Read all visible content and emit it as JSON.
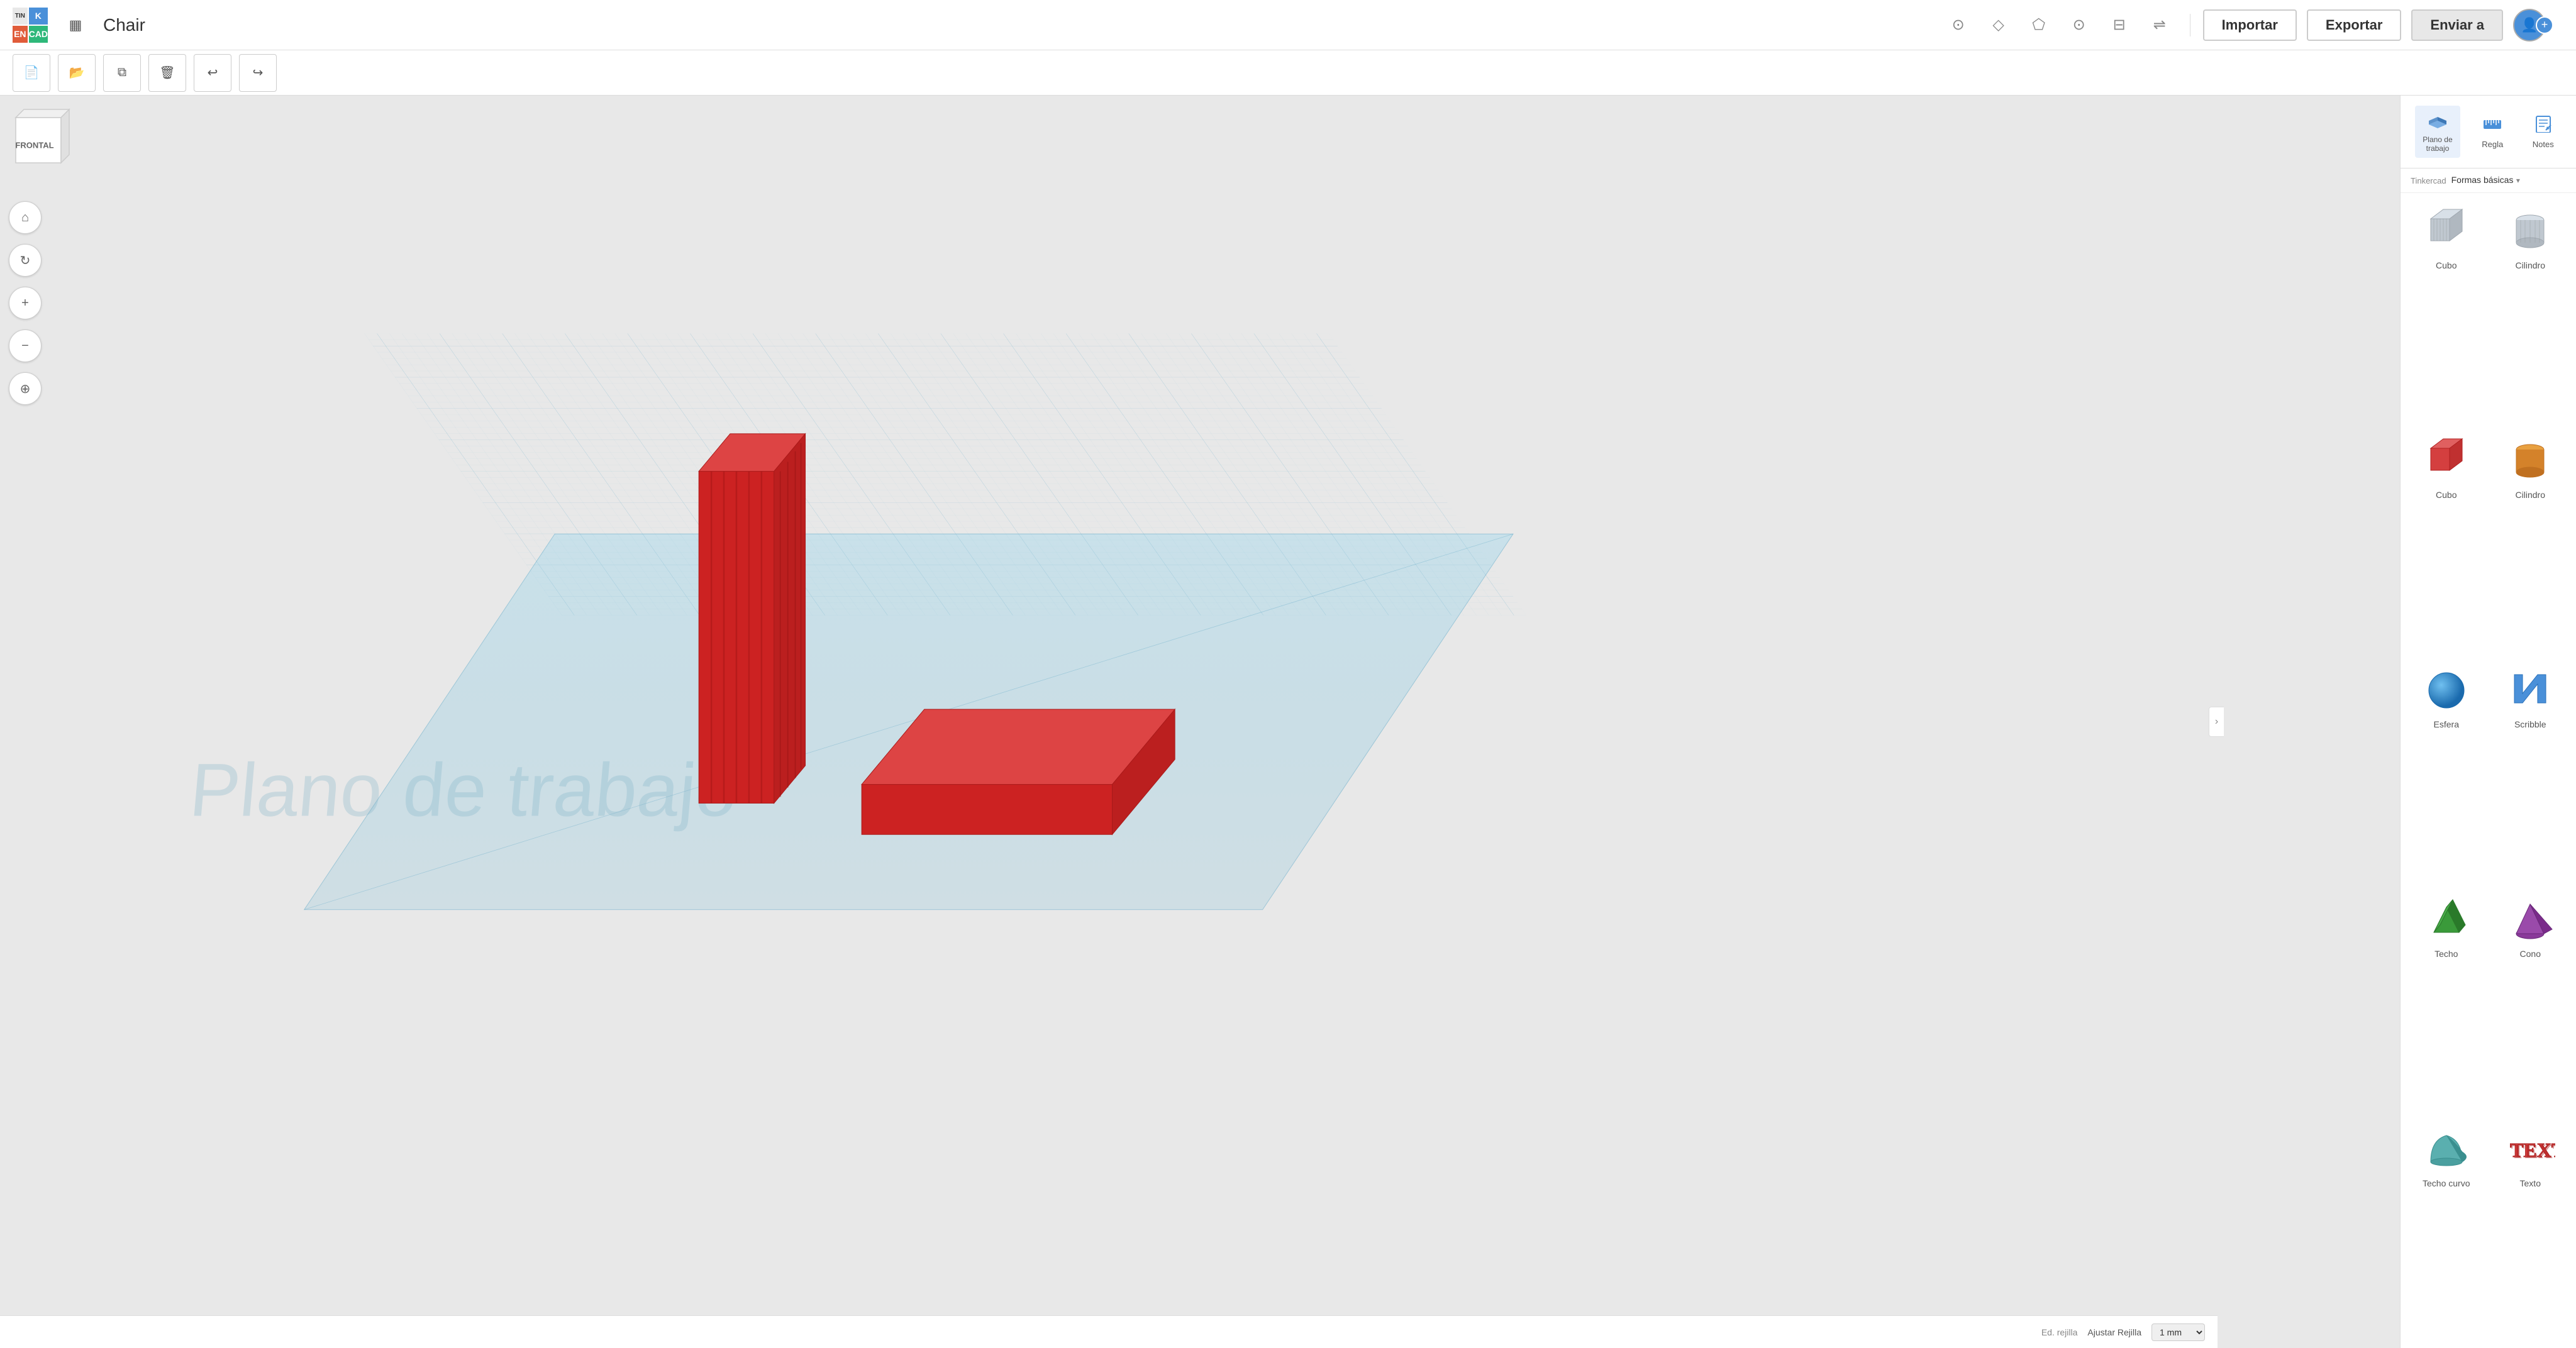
{
  "app": {
    "title": "Chair",
    "logo": {
      "cell1": "TIN",
      "cell2": "K",
      "cell3": "EN",
      "cell4": "CAD"
    }
  },
  "topbar": {
    "importar_label": "Importar",
    "exportar_label": "Exportar",
    "enviar_label": "Enviar a"
  },
  "toolbar2": {
    "buttons": [
      "new",
      "copy",
      "paste",
      "delete",
      "undo",
      "redo"
    ]
  },
  "left_controls": {
    "buttons": [
      "home",
      "orbit",
      "zoom_in",
      "zoom_out",
      "fit"
    ]
  },
  "viewport": {
    "workplane_label": "Plano de trabajo",
    "front_label": "FRONTAL"
  },
  "right_panel": {
    "plano_label": "Plano de\ntrabajo",
    "regla_label": "Regla",
    "notes_label": "Notes",
    "tinkercad_label": "Tinkercad",
    "category_label": "Formas básicas",
    "shapes": [
      {
        "id": "cubo-gray",
        "label": "Cubo",
        "color": "#b0b8c0",
        "type": "cube_gray"
      },
      {
        "id": "cilindro-gray",
        "label": "Cilindro",
        "color": "#b0b8c0",
        "type": "cylinder_gray"
      },
      {
        "id": "cubo-red",
        "label": "Cubo",
        "color": "#d43f3f",
        "type": "cube_red"
      },
      {
        "id": "cilindro-orange",
        "label": "Cilindro",
        "color": "#d4822a",
        "type": "cylinder_orange"
      },
      {
        "id": "esfera",
        "label": "Esfera",
        "color": "#3a90d4",
        "type": "sphere"
      },
      {
        "id": "scribble",
        "label": "Scribble",
        "color": "#4a90d9",
        "type": "scribble"
      },
      {
        "id": "techo",
        "label": "Techo",
        "color": "#3a9a3a",
        "type": "roof"
      },
      {
        "id": "cono",
        "label": "Cono",
        "color": "#7a3a9a",
        "type": "cone"
      },
      {
        "id": "techo-curvo",
        "label": "Techo curvo",
        "color": "#5aafaf",
        "type": "curved_roof"
      },
      {
        "id": "texto",
        "label": "Texto",
        "color": "#d43f3f",
        "type": "text"
      }
    ]
  },
  "bottom": {
    "grid_label": "Ed. rejilla",
    "adjust_label": "Ajustar Rejilla",
    "grid_value": "1 mm"
  }
}
